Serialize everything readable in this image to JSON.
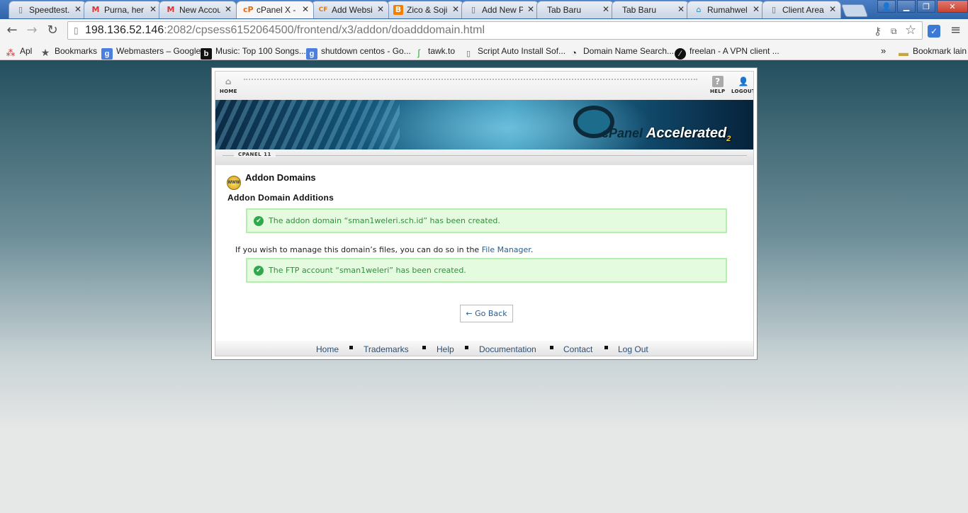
{
  "browser": {
    "tabs": [
      {
        "title": "Speedtest.",
        "icon": "page-icon",
        "active": false
      },
      {
        "title": "Purna, her",
        "icon": "gmail-icon",
        "active": false
      },
      {
        "title": "New Accou",
        "icon": "gmail-icon",
        "active": false
      },
      {
        "title": "cPanel X -",
        "icon": "cpanel-icon",
        "active": true
      },
      {
        "title": "Add Websi",
        "icon": "cf-icon",
        "active": false
      },
      {
        "title": "Zico & Soji",
        "icon": "blogger-icon",
        "active": false
      },
      {
        "title": "Add New P",
        "icon": "page-icon",
        "active": false
      },
      {
        "title": "Tab Baru",
        "icon": "none",
        "active": false
      },
      {
        "title": "Tab Baru",
        "icon": "none",
        "active": false
      },
      {
        "title": "Rumahwel",
        "icon": "house-icon",
        "active": false
      },
      {
        "title": "Client Area",
        "icon": "page-icon",
        "active": false
      }
    ],
    "url_host": "198.136.52.146",
    "url_rest": ":2082/cpsess6152064500/frontend/x3/addon/doadddomain.html",
    "bookmarks": [
      {
        "label": "Apl",
        "icon": "apps-grid-icon"
      },
      {
        "label": "Bookmarks",
        "icon": "star-icon"
      },
      {
        "label": "Webmasters – Google",
        "icon": "google-icon"
      },
      {
        "label": "Music: Top 100 Songs...",
        "icon": "b-icon"
      },
      {
        "label": "shutdown centos - Go...",
        "icon": "google-icon"
      },
      {
        "label": "tawk.to",
        "icon": "tawk-icon"
      },
      {
        "label": "Script Auto Install Sof...",
        "icon": "page-icon"
      },
      {
        "label": "Domain Name Search...",
        "icon": "clock-icon"
      },
      {
        "label": "freelan - A VPN client ...",
        "icon": "freelan-icon"
      }
    ],
    "bookmarks_more": "»",
    "other_bookmarks": "Bookmark lain"
  },
  "cpanel": {
    "home_label": "HOME",
    "help_label": "HELP",
    "logout_label": "LOGOUT",
    "brand": "cPanel",
    "brand_accel": "Accelerated",
    "brand_num": "2",
    "version": "CPANEL 11",
    "page_title": "Addon Domains",
    "section_title": "Addon Domain Additions",
    "success_domain": "The addon domain “sman1weleri.sch.id” has been created.",
    "info_text": "If you wish to manage this domain’s files, you can do so in the ",
    "info_link": "File Manager",
    "info_end": ".",
    "success_ftp": "The FTP account “sman1weleri” has been created.",
    "go_back": "← Go Back",
    "footer": [
      "Home",
      "Trademarks",
      "Help",
      "Documentation",
      "Contact",
      "Log Out"
    ]
  }
}
